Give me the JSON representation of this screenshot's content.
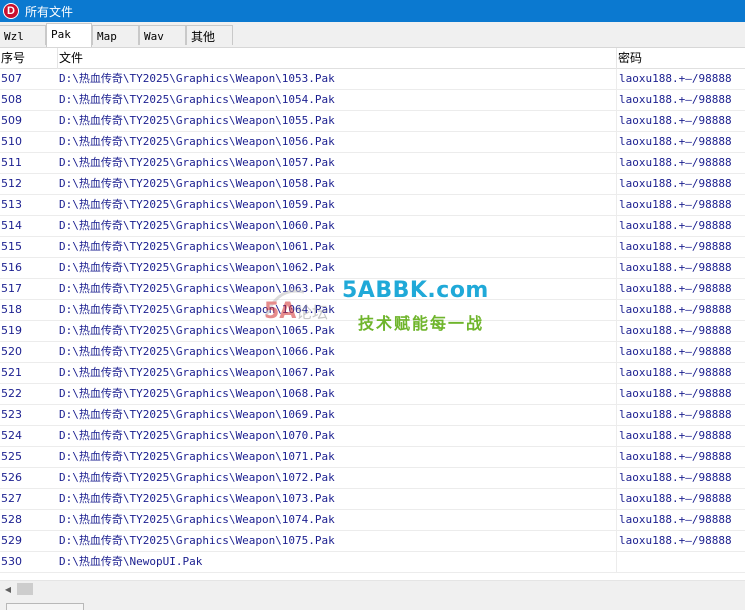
{
  "window": {
    "icon_letter": "D",
    "title": "所有文件"
  },
  "tabs": [
    {
      "label": "Wzl"
    },
    {
      "label": "Pak",
      "active": true
    },
    {
      "label": "Map"
    },
    {
      "label": "Wav"
    },
    {
      "label": "其他"
    }
  ],
  "table": {
    "headers": {
      "no": "序号",
      "file": "文件",
      "password": "密码"
    },
    "rows": [
      {
        "no": "507",
        "file": "D:\\热血传奇\\TY2025\\Graphics\\Weapon\\1053.Pak",
        "password": "laoxu188.+—/98888"
      },
      {
        "no": "508",
        "file": "D:\\热血传奇\\TY2025\\Graphics\\Weapon\\1054.Pak",
        "password": "laoxu188.+—/98888"
      },
      {
        "no": "509",
        "file": "D:\\热血传奇\\TY2025\\Graphics\\Weapon\\1055.Pak",
        "password": "laoxu188.+—/98888"
      },
      {
        "no": "510",
        "file": "D:\\热血传奇\\TY2025\\Graphics\\Weapon\\1056.Pak",
        "password": "laoxu188.+—/98888"
      },
      {
        "no": "511",
        "file": "D:\\热血传奇\\TY2025\\Graphics\\Weapon\\1057.Pak",
        "password": "laoxu188.+—/98888"
      },
      {
        "no": "512",
        "file": "D:\\热血传奇\\TY2025\\Graphics\\Weapon\\1058.Pak",
        "password": "laoxu188.+—/98888"
      },
      {
        "no": "513",
        "file": "D:\\热血传奇\\TY2025\\Graphics\\Weapon\\1059.Pak",
        "password": "laoxu188.+—/98888"
      },
      {
        "no": "514",
        "file": "D:\\热血传奇\\TY2025\\Graphics\\Weapon\\1060.Pak",
        "password": "laoxu188.+—/98888"
      },
      {
        "no": "515",
        "file": "D:\\热血传奇\\TY2025\\Graphics\\Weapon\\1061.Pak",
        "password": "laoxu188.+—/98888"
      },
      {
        "no": "516",
        "file": "D:\\热血传奇\\TY2025\\Graphics\\Weapon\\1062.Pak",
        "password": "laoxu188.+—/98888"
      },
      {
        "no": "517",
        "file": "D:\\热血传奇\\TY2025\\Graphics\\Weapon\\1063.Pak",
        "password": "laoxu188.+—/98888"
      },
      {
        "no": "518",
        "file": "D:\\热血传奇\\TY2025\\Graphics\\Weapon\\1064.Pak",
        "password": "laoxu188.+—/98888"
      },
      {
        "no": "519",
        "file": "D:\\热血传奇\\TY2025\\Graphics\\Weapon\\1065.Pak",
        "password": "laoxu188.+—/98888"
      },
      {
        "no": "520",
        "file": "D:\\热血传奇\\TY2025\\Graphics\\Weapon\\1066.Pak",
        "password": "laoxu188.+—/98888"
      },
      {
        "no": "521",
        "file": "D:\\热血传奇\\TY2025\\Graphics\\Weapon\\1067.Pak",
        "password": "laoxu188.+—/98888"
      },
      {
        "no": "522",
        "file": "D:\\热血传奇\\TY2025\\Graphics\\Weapon\\1068.Pak",
        "password": "laoxu188.+—/98888"
      },
      {
        "no": "523",
        "file": "D:\\热血传奇\\TY2025\\Graphics\\Weapon\\1069.Pak",
        "password": "laoxu188.+—/98888"
      },
      {
        "no": "524",
        "file": "D:\\热血传奇\\TY2025\\Graphics\\Weapon\\1070.Pak",
        "password": "laoxu188.+—/98888"
      },
      {
        "no": "525",
        "file": "D:\\热血传奇\\TY2025\\Graphics\\Weapon\\1071.Pak",
        "password": "laoxu188.+—/98888"
      },
      {
        "no": "526",
        "file": "D:\\热血传奇\\TY2025\\Graphics\\Weapon\\1072.Pak",
        "password": "laoxu188.+—/98888"
      },
      {
        "no": "527",
        "file": "D:\\热血传奇\\TY2025\\Graphics\\Weapon\\1073.Pak",
        "password": "laoxu188.+—/98888"
      },
      {
        "no": "528",
        "file": "D:\\热血传奇\\TY2025\\Graphics\\Weapon\\1074.Pak",
        "password": "laoxu188.+—/98888"
      },
      {
        "no": "529",
        "file": "D:\\热血传奇\\TY2025\\Graphics\\Weapon\\1075.Pak",
        "password": "laoxu188.+—/98888"
      },
      {
        "no": "530",
        "file": "D:\\热血传奇\\NewopUI.Pak",
        "password": ""
      }
    ]
  },
  "watermark": {
    "site": "5ABBK.com",
    "slogan": "技术赋能每一战",
    "logo_text": "5A论坛"
  },
  "colors": {
    "titlebar": "#0b79d0",
    "row_text": "#1a1e8f",
    "watermark_site": "#20a9d8",
    "watermark_slogan": "#6fb52c"
  }
}
